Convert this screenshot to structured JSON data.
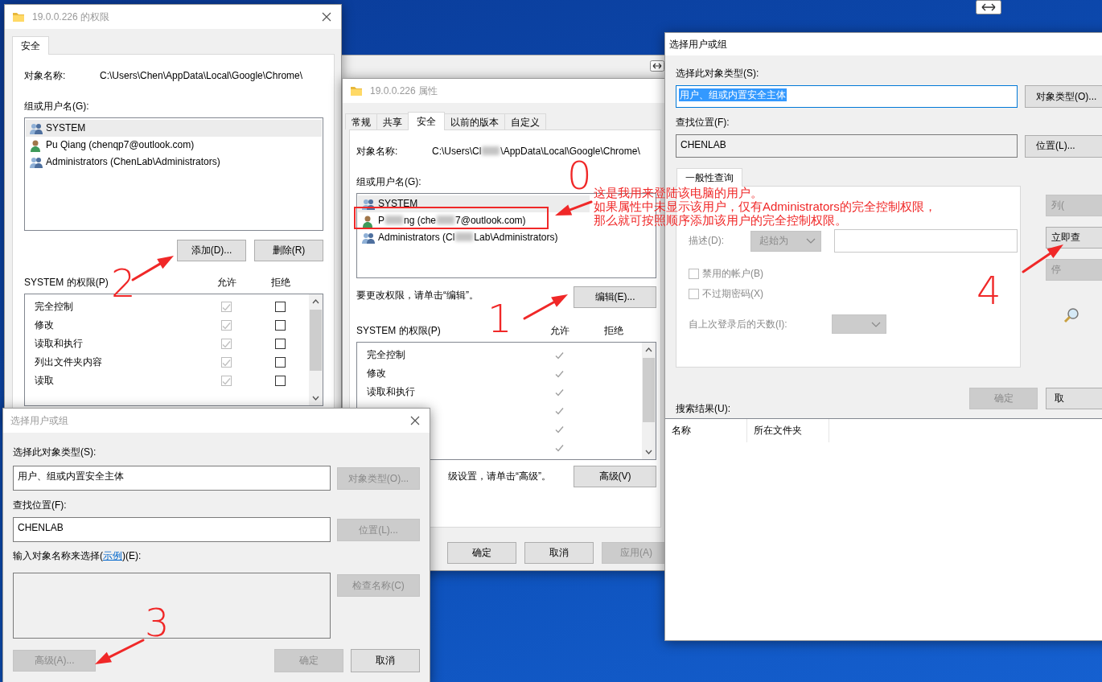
{
  "permissions_window": {
    "title": "19.0.0.226 的权限",
    "tabs": [
      {
        "label": "安全",
        "selected": true
      }
    ],
    "object_name_label": "对象名称:",
    "object_name": "C:\\Users\\Chen\\AppData\\Local\\Google\\Chrome\\",
    "users_label": "组或用户名(G):",
    "users": [
      {
        "kind": "group",
        "name": "SYSTEM",
        "selected": true
      },
      {
        "kind": "user",
        "name": "Pu Qiang (chenqp7@outlook.com)",
        "selected": false
      },
      {
        "kind": "group",
        "name": "Administrators (ChenLab\\Administrators)",
        "selected": false
      }
    ],
    "buttons": [
      {
        "label": "添加(D)...",
        "disabled": false
      },
      {
        "label": "删除(R)",
        "disabled": false
      }
    ],
    "permissions_label": "SYSTEM 的权限(P)",
    "allow_header": "允许",
    "deny_header": "拒绝",
    "permissions": [
      {
        "name": "完全控制",
        "allow": true,
        "deny": false
      },
      {
        "name": "修改",
        "allow": true,
        "deny": false
      },
      {
        "name": "读取和执行",
        "allow": true,
        "deny": false
      },
      {
        "name": "列出文件夹内容",
        "allow": true,
        "deny": false
      },
      {
        "name": "读取",
        "allow": true,
        "deny": false
      }
    ]
  },
  "properties_window": {
    "title": "19.0.0.226 属性",
    "tabs": [
      {
        "label": "常规",
        "selected": false
      },
      {
        "label": "共享",
        "selected": false
      },
      {
        "label": "安全",
        "selected": true
      },
      {
        "label": "以前的版本",
        "selected": false
      },
      {
        "label": "自定义",
        "selected": false
      }
    ],
    "object_name_label": "对象名称:",
    "object_name": [
      "C:\\Users\\Cl",
      "\\AppData\\Local\\Google\\Chrome\\"
    ],
    "users_label": "组或用户名(G):",
    "users": [
      {
        "kind": "group",
        "name": [
          "SYSTEM"
        ],
        "selected": true,
        "boxed": false
      },
      {
        "kind": "user",
        "name": [
          "P",
          "ng (che",
          "7@outlook.com)"
        ],
        "selected": false,
        "boxed": true
      },
      {
        "kind": "group",
        "name": [
          "Administrators (Cl",
          "Lab\\Administrators)"
        ],
        "selected": false,
        "boxed": false
      }
    ],
    "edit_hint": "要更改权限，请单击“编辑”。",
    "edit_button": {
      "label": "编辑(E)...",
      "disabled": false
    },
    "permissions_label": "SYSTEM 的权限(P)",
    "allow_header": "允许",
    "deny_header": "拒绝",
    "permissions": [
      {
        "name": "完全控制",
        "allow": true
      },
      {
        "name": "修改",
        "allow": true
      },
      {
        "name": "读取和执行",
        "allow": true
      },
      {
        "allow": true
      },
      {
        "allow": true
      },
      {
        "allow": true
      }
    ],
    "advanced_hint": "级设置，请单击“高级”。",
    "advanced_button": {
      "label": "高级(V)",
      "disabled": false
    },
    "buttons": [
      {
        "label": "确定",
        "disabled": false
      },
      {
        "label": "取消",
        "disabled": false
      },
      {
        "label": "应用(A)",
        "disabled": true
      }
    ]
  },
  "advanced_window": {
    "title": "选择用户或组",
    "object_type_label": "选择此对象类型(S):",
    "object_type": {
      "value": "用户、组或内置安全主体",
      "selected": true
    },
    "object_type_button": {
      "label": "对象类型(O)...",
      "disabled": false
    },
    "location_label": "查找位置(F):",
    "location": "CHENLAB",
    "location_button": {
      "label": "位置(L)...",
      "disabled": false
    },
    "tabs": [
      {
        "label": "一般性查询",
        "selected": true
      }
    ],
    "query_rows": [
      {
        "kind": "covered"
      },
      {
        "kind": "plain",
        "label": "描述(D):",
        "mode": "起始为"
      }
    ],
    "checkboxes": [
      {
        "label": "禁用的帐户(B)",
        "checked": false
      },
      {
        "label": "不过期密码(X)",
        "checked": false
      }
    ],
    "days_label": "自上次登录后的天数(I):",
    "side_buttons": [
      {
        "label": "列(",
        "disabled": true
      },
      {
        "label": "立即查",
        "disabled": false
      },
      {
        "label": "停",
        "disabled": true
      }
    ],
    "buttons": [
      {
        "label": "确定",
        "disabled": true
      },
      {
        "label": "取",
        "disabled": false
      }
    ],
    "results_label": "搜索结果(U):",
    "result_columns": [
      "名称",
      "所在文件夹"
    ]
  },
  "select_window": {
    "title": "选择用户或组",
    "object_type_label": "选择此对象类型(S):",
    "object_type": "用户、组或内置安全主体",
    "object_type_button": {
      "label": "对象类型(O)...",
      "disabled": true
    },
    "location_label": "查找位置(F):",
    "location": "CHENLAB",
    "location_button": {
      "label": "位置(L)...",
      "disabled": true
    },
    "names_label": {
      "before": "输入对象名称来选择(",
      "link": "示例",
      "after": ")(E):"
    },
    "check_button": {
      "label": "检查名称(C)",
      "disabled": true
    },
    "advanced_button": {
      "label": "高级(A)...",
      "disabled": true
    },
    "buttons": [
      {
        "label": "确定",
        "disabled": true
      },
      {
        "label": "取消",
        "disabled": false
      }
    ]
  },
  "annotations": {
    "note_lines": [
      "这是我用来登陆该电脑的用户。",
      "如果属性中未显示该用户，仅有Administrators的完全控制权限，",
      "那么就可按照顺序添加该用户的完全控制权限。"
    ],
    "step_labels": [
      "0",
      "1",
      "2",
      "3",
      "4"
    ]
  }
}
